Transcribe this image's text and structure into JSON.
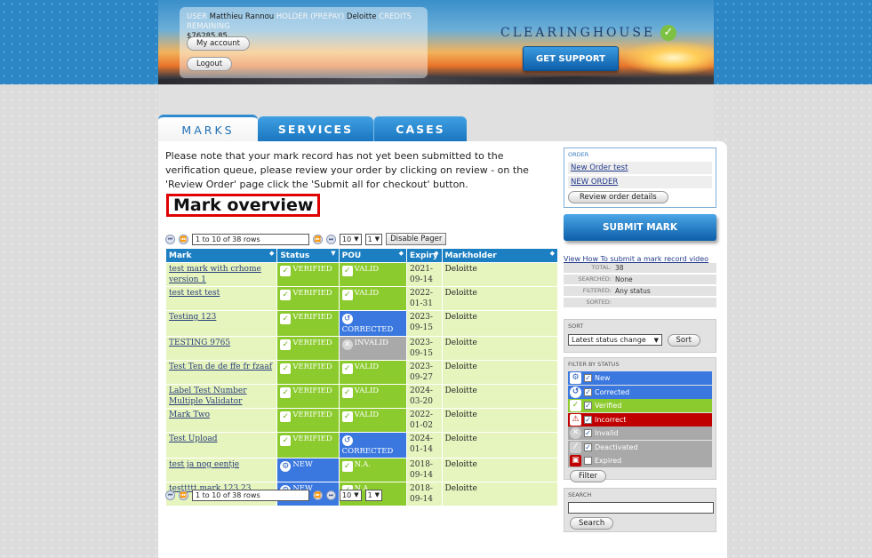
{
  "header": {
    "user_label": "USER",
    "user_name": "Matthieu Rannou",
    "holder_label": "HOLDER (PREPAY)",
    "holder_name": "Deloitte",
    "credits_label": "CREDITS REMAINING",
    "credits_value": "$76285.85",
    "my_account": "My account",
    "logout": "Logout",
    "brand": "CLEARINGHOUSE",
    "get_support": "GET SUPPORT",
    "brand_check": "✓"
  },
  "tabs": [
    {
      "label": "MARKS",
      "active": true
    },
    {
      "label": "SERVICES",
      "active": false
    },
    {
      "label": "CASES",
      "active": false
    }
  ],
  "notice": "Please note that your mark record has not yet been submitted to the verification queue, please review your order by clicking on review - on the 'Review Order' page click the 'Submit all for checkout' button.",
  "overview_title": "Mark overview",
  "pager": {
    "range": "1 to 10 of 38 rows",
    "per_page": "10",
    "page": "1",
    "disable_label": "Disable Pager"
  },
  "table": {
    "headers": {
      "mark": "Mark",
      "status": "Status",
      "pou": "POU",
      "expiry": "Expiry",
      "holder": "Markholder"
    },
    "rows": [
      {
        "mark": "test mark with crhome version 1",
        "status": "VERIFIED",
        "pou": "VALID",
        "expiry": "2021-09-14",
        "holder": "Deloitte"
      },
      {
        "mark": "test test test",
        "status": "VERIFIED",
        "pou": "VALID",
        "expiry": "2022-01-31",
        "holder": "Deloitte"
      },
      {
        "mark": "Testing 123",
        "status": "VERIFIED",
        "pou": "CORRECTED",
        "expiry": "2023-09-15",
        "holder": "Deloitte"
      },
      {
        "mark": "TESTING 9765",
        "status": "VERIFIED",
        "pou": "INVALID",
        "expiry": "2023-09-15",
        "holder": "Deloitte"
      },
      {
        "mark": "Test Ten de de ffe fr fzaaf",
        "status": "VERIFIED",
        "pou": "VALID",
        "expiry": "2023-09-27",
        "holder": "Deloitte"
      },
      {
        "mark": "Label Test Number Multiple Validator",
        "status": "VERIFIED",
        "pou": "VALID",
        "expiry": "2024-03-20",
        "holder": "Deloitte"
      },
      {
        "mark": "Mark Two",
        "status": "VERIFIED",
        "pou": "VALID",
        "expiry": "2022-01-02",
        "holder": "Deloitte"
      },
      {
        "mark": "Test Upload",
        "status": "VERIFIED",
        "pou": "CORRECTED",
        "expiry": "2024-01-14",
        "holder": "Deloitte"
      },
      {
        "mark": "test ja nog eentje",
        "status": "NEW",
        "pou": "N.A.",
        "expiry": "2018-09-14",
        "holder": "Deloitte"
      },
      {
        "mark": "testtttt mark 123 23",
        "status": "NEW",
        "pou": "N.A.",
        "expiry": "2018-09-14",
        "holder": "Deloitte"
      }
    ]
  },
  "order": {
    "label": "ORDER",
    "items": [
      "New Order test",
      "NEW ORDER"
    ],
    "review_btn": "Review order details"
  },
  "submit_mark": "SUBMIT MARK",
  "howto_link": "View How To submit a mark record video",
  "stats": [
    {
      "k": "TOTAL:",
      "v": "38"
    },
    {
      "k": "SEARCHED:",
      "v": "None"
    },
    {
      "k": "FILTERED:",
      "v": "Any status"
    },
    {
      "k": "SORTED:",
      "v": ""
    }
  ],
  "sort": {
    "label": "SORT",
    "value": "Latest status change",
    "btn": "Sort"
  },
  "filter": {
    "label": "FILTER BY STATUS",
    "items": [
      {
        "label": "New",
        "checked": true
      },
      {
        "label": "Corrected",
        "checked": true
      },
      {
        "label": "Verified",
        "checked": true
      },
      {
        "label": "Incorrect",
        "checked": true
      },
      {
        "label": "Invalid",
        "checked": true
      },
      {
        "label": "Deactivated",
        "checked": true
      },
      {
        "label": "Expired",
        "checked": false
      }
    ],
    "btn": "Filter"
  },
  "search": {
    "label": "SEARCH",
    "btn": "Search"
  },
  "colors": {
    "verified": "#8ccb2e",
    "new": "#3a78e0",
    "incorrect": "#c00000",
    "invalid": "#a9a9a9",
    "header_blue": "#1c7fc2"
  }
}
